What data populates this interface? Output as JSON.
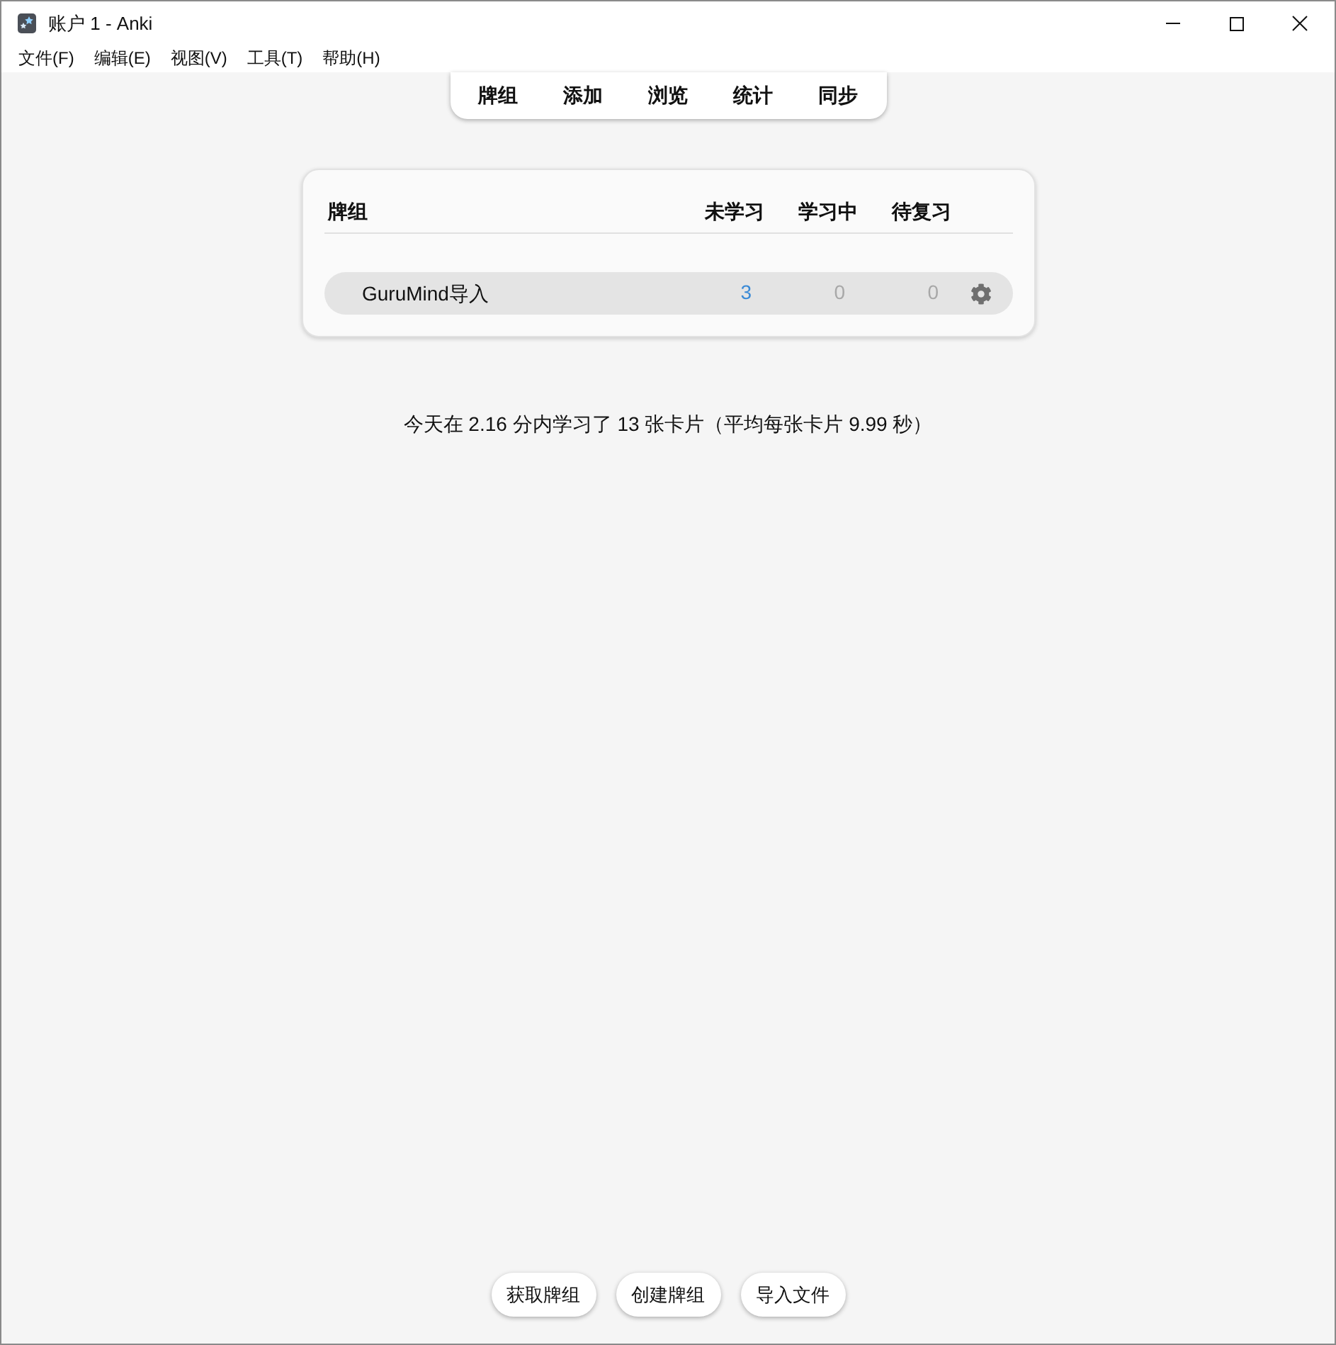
{
  "window": {
    "title": "账户 1 - Anki"
  },
  "menu_bar": [
    "文件(F)",
    "编辑(E)",
    "视图(V)",
    "工具(T)",
    "帮助(H)"
  ],
  "toolbar": [
    "牌组",
    "添加",
    "浏览",
    "统计",
    "同步"
  ],
  "deck_table": {
    "columns": [
      "牌组",
      "未学习",
      "学习中",
      "待复习"
    ],
    "rows": [
      {
        "name": "GuruMind导入",
        "current": true,
        "counts": [
          {
            "value": "3",
            "color": "#3a8ad6"
          },
          {
            "value": "0",
            "color": "#a8a8a8"
          },
          {
            "value": "0",
            "color": "#a8a8a8"
          }
        ]
      }
    ]
  },
  "stats": "今天在 2.16 分内学习了 13 张卡片（平均每张卡片 9.99 秒）",
  "buttons": [
    "获取牌组",
    "创建牌组",
    "导入文件"
  ]
}
